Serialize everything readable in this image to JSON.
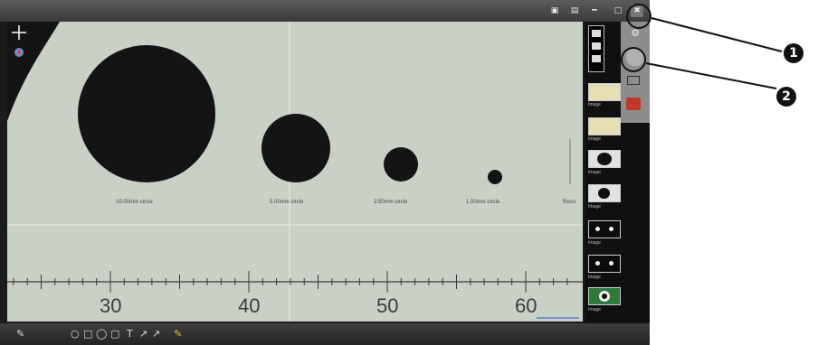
{
  "topbar": {
    "buttons": [
      "▣",
      "▤",
      "━",
      "□",
      "✖"
    ]
  },
  "viewer": {
    "circles": [
      {
        "label": "10.00mm circle"
      },
      {
        "label": "5.00mm circle"
      },
      {
        "label": "2.50mm circle"
      },
      {
        "label": "1.00mm circle"
      }
    ],
    "edge_label": "Reso",
    "ruler_numbers": [
      "30",
      "40",
      "50",
      "60"
    ]
  },
  "sidebar": {
    "thumbnails": [
      {
        "label": "Image",
        "info": ""
      },
      {
        "label": "Image",
        "info": ""
      },
      {
        "label": "Image",
        "info": ""
      },
      {
        "label": "Image",
        "info": ""
      },
      {
        "label": "Image",
        "info": ""
      },
      {
        "label": "Image",
        "info": ""
      },
      {
        "label": "Image",
        "info": ""
      }
    ]
  },
  "callouts": {
    "one": "1",
    "two": "2"
  },
  "colors": {
    "viewer_bg": "#c9d1c6",
    "disk": "#141414",
    "accent_red": "#c0392b"
  }
}
